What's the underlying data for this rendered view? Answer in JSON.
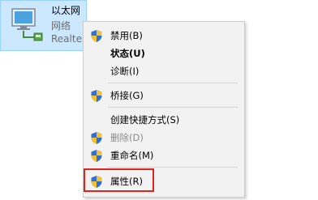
{
  "adapter": {
    "name": "以太网",
    "status": "网络",
    "device": "Realtek"
  },
  "menu": {
    "items": [
      {
        "label": "禁用(B)",
        "shield": true,
        "disabled": false,
        "bold": false
      },
      {
        "label": "状态(U)",
        "shield": false,
        "disabled": false,
        "bold": true
      },
      {
        "label": "诊断(I)",
        "shield": false,
        "disabled": false,
        "bold": false
      },
      {
        "label": "桥接(G)",
        "shield": true,
        "disabled": false,
        "bold": false
      },
      {
        "label": "创建快捷方式(S)",
        "shield": false,
        "disabled": false,
        "bold": false
      },
      {
        "label": "删除(D)",
        "shield": true,
        "disabled": true,
        "bold": false
      },
      {
        "label": "重命名(M)",
        "shield": true,
        "disabled": false,
        "bold": false
      },
      {
        "label": "属性(R)",
        "shield": true,
        "disabled": false,
        "bold": false
      }
    ]
  },
  "colors": {
    "selection_background": "#cce8ff",
    "menu_background": "#f2f2f2",
    "highlight_border": "#e0231d",
    "shield_blue": "#2f6fd6",
    "shield_yellow": "#f2c230"
  }
}
